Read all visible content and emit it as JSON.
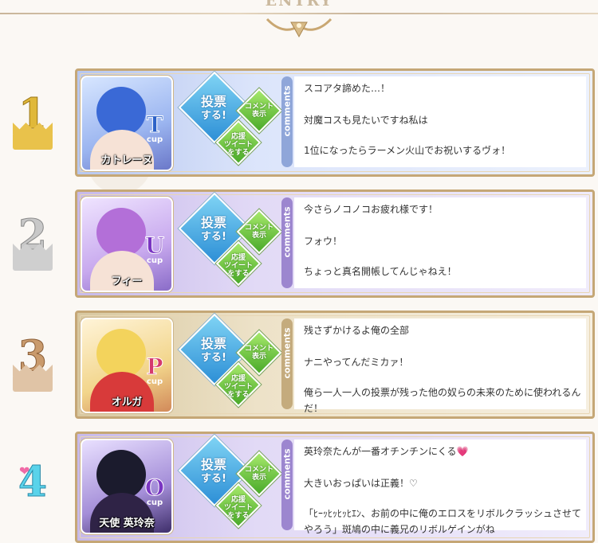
{
  "header": {
    "title": "ENTRY"
  },
  "colors": {
    "frame": "#c5a776",
    "vote_blue": "#2d8fd6",
    "button_green": "#4aaa2a"
  },
  "entries": [
    {
      "rank": "1",
      "name": "カトレーヌ",
      "cup_letter": "T",
      "cup_word": "cup",
      "vote_top": "投票",
      "vote_bottom": "する!",
      "comment_top": "コメント",
      "comment_bottom": "表示",
      "tweet_top": "応援",
      "tweet_mid": "ツイート",
      "tweet_bottom": "をする",
      "comments_label": "comments",
      "comments": [
        "スコアタ諦めた…！",
        "対魔コスも見たいですね私は",
        "1位になったらラーメン火山でお祝いするヴォ！"
      ]
    },
    {
      "rank": "2",
      "name": "フィー",
      "cup_letter": "U",
      "cup_word": "cup",
      "vote_top": "投票",
      "vote_bottom": "する!",
      "comment_top": "コメント",
      "comment_bottom": "表示",
      "tweet_top": "応援",
      "tweet_mid": "ツイート",
      "tweet_bottom": "をする",
      "comments_label": "comments",
      "comments": [
        "今さらノコノコお疲れ様です！",
        "フォウ！",
        "ちょっと真名開帳してんじゃねえ！"
      ]
    },
    {
      "rank": "3",
      "name": "オルガ",
      "cup_letter": "P",
      "cup_word": "cup",
      "vote_top": "投票",
      "vote_bottom": "する!",
      "comment_top": "コメント",
      "comment_bottom": "表示",
      "tweet_top": "応援",
      "tweet_mid": "ツイート",
      "tweet_bottom": "をする",
      "comments_label": "comments",
      "comments": [
        "残さずかけるよ俺の全部",
        "ナニやってんだミカァ！",
        "俺ら一人一人の投票が残った他の奴らの未来のために使われるんだ！"
      ]
    },
    {
      "rank": "4",
      "name": "天使 英玲奈",
      "cup_letter": "O",
      "cup_word": "cup",
      "vote_top": "投票",
      "vote_bottom": "する!",
      "comment_top": "コメント",
      "comment_bottom": "表示",
      "tweet_top": "応援",
      "tweet_mid": "ツイート",
      "tweet_bottom": "をする",
      "comments_label": "comments",
      "comments": [
        "英玲奈たんが一番オチンチンにくる💗",
        "大きいおっぱいは正義！♡",
        "「ﾋｰｯﾋｯﾋｯﾋｴﾝ、お前の中に俺のエロスをリボルクラッシュさせてやろう」斑鳩の中に義兄のリボルゲインがね"
      ]
    }
  ]
}
